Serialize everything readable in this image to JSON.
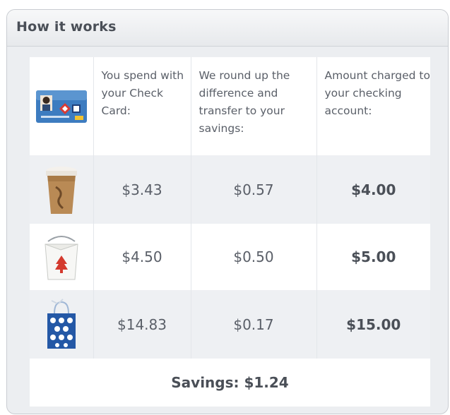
{
  "panel": {
    "title": "How it works"
  },
  "table": {
    "header": {
      "image": "check-card",
      "spend_label": "You spend with your Check Card:",
      "roundup_label": "We round up the difference and transfer to your savings:",
      "charged_label": "Amount charged to your checking account:"
    },
    "rows": [
      {
        "image": "coffee-cup",
        "spend": "$3.43",
        "roundup": "$0.57",
        "charged": "$4.00"
      },
      {
        "image": "takeout-box",
        "spend": "$4.50",
        "roundup": "$0.50",
        "charged": "$5.00"
      },
      {
        "image": "gift-bag",
        "spend": "$14.83",
        "roundup": "$0.17",
        "charged": "$15.00"
      }
    ],
    "savings": "Savings: $1.24"
  },
  "colors": {
    "card_blue": "#2f6fb5",
    "card_red": "#c8322f",
    "bag_blue": "#2458a6"
  }
}
